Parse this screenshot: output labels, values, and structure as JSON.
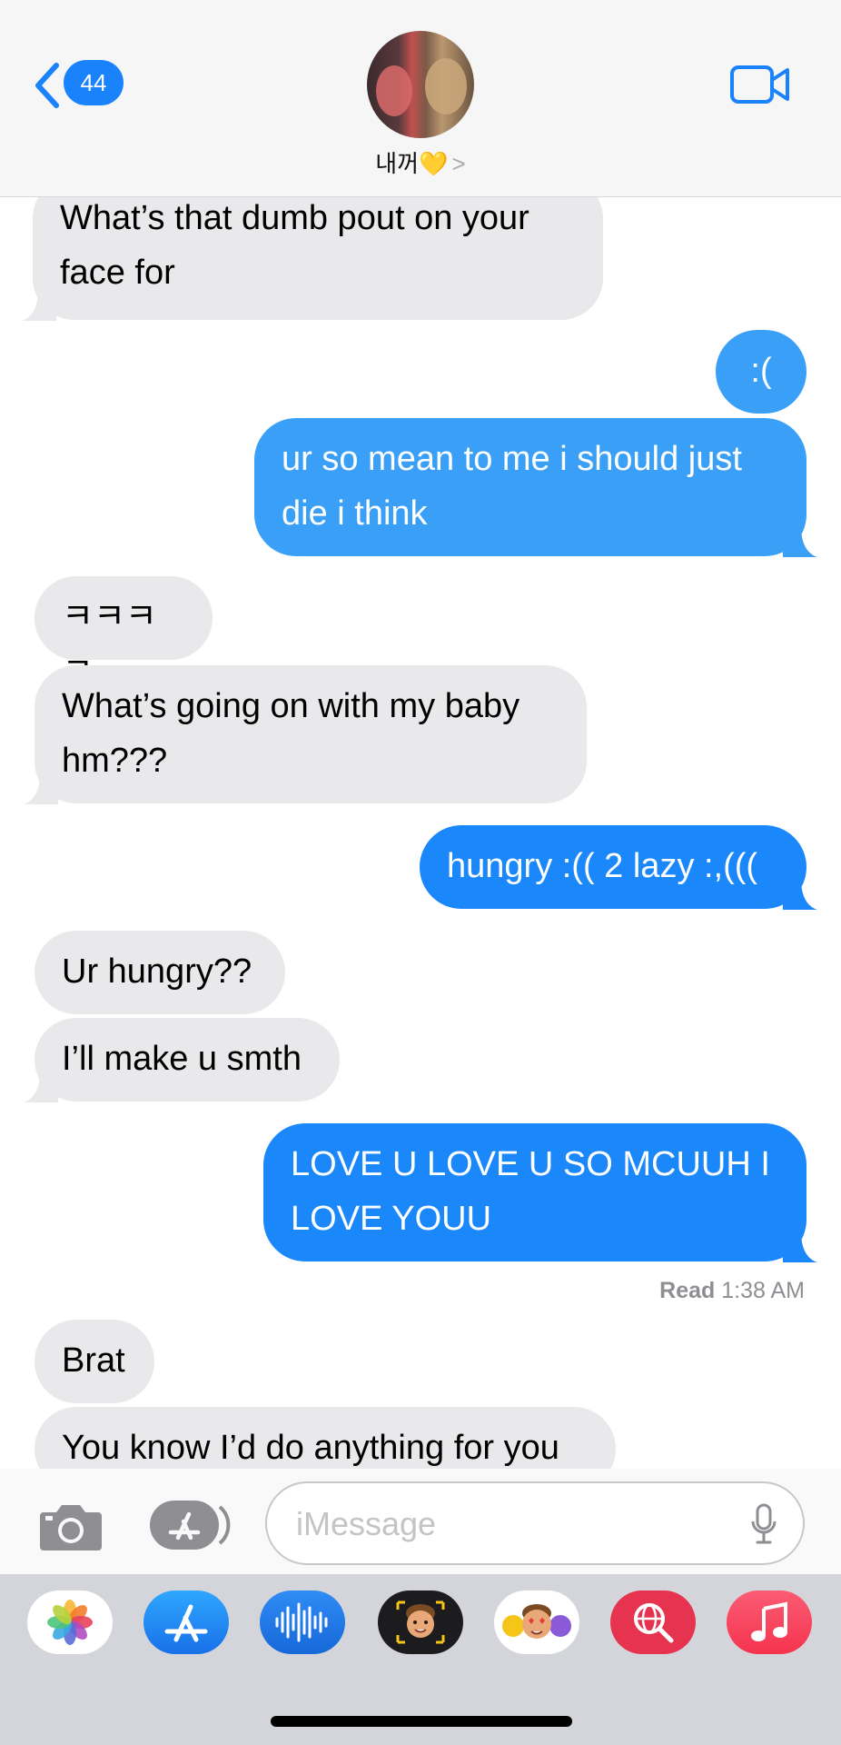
{
  "header": {
    "unread_count": "44",
    "contact_name": "내꺼💛",
    "chevron": ">"
  },
  "messages": [
    {
      "dir": "in",
      "text": "What’s that dumb pout on your face for",
      "tail": true
    },
    {
      "dir": "out",
      "text": ":(",
      "tail": false
    },
    {
      "dir": "out",
      "text": "ur so mean to me i should just die i think",
      "tail": true
    },
    {
      "dir": "in",
      "text": "ㅋㅋㅋㅋ",
      "tail": false
    },
    {
      "dir": "in",
      "text": "What’s going on with my baby hm???",
      "tail": true
    },
    {
      "dir": "out",
      "text": "hungry :(( 2 lazy :,(((",
      "tail": true
    },
    {
      "dir": "in",
      "text": "Ur hungry??",
      "tail": false
    },
    {
      "dir": "in",
      "text": "I’ll make u smth",
      "tail": true
    },
    {
      "dir": "out",
      "text": "LOVE U LOVE U SO MCUUH I LOVE YOUU",
      "tail": true
    },
    {
      "dir": "in",
      "text": "Brat",
      "tail": false
    },
    {
      "dir": "in",
      "text": "You know I’d do anything for you",
      "tail": false
    }
  ],
  "read_receipt": {
    "label": "Read",
    "time": "1:38 AM"
  },
  "input": {
    "placeholder": "iMessage"
  },
  "app_drawer": {
    "apps": [
      {
        "name": "photos-app-icon"
      },
      {
        "name": "app-store-app-icon"
      },
      {
        "name": "audio-message-app-icon"
      },
      {
        "name": "memoji-app-icon"
      },
      {
        "name": "memoji-stickers-app-icon"
      },
      {
        "name": "images-search-app-icon"
      },
      {
        "name": "music-app-icon"
      }
    ]
  },
  "colors": {
    "accent": "#1a82fb",
    "bubble_out": "#1a87fb",
    "bubble_in": "#e9e9eb",
    "drawer_bg": "#d4d5da"
  }
}
